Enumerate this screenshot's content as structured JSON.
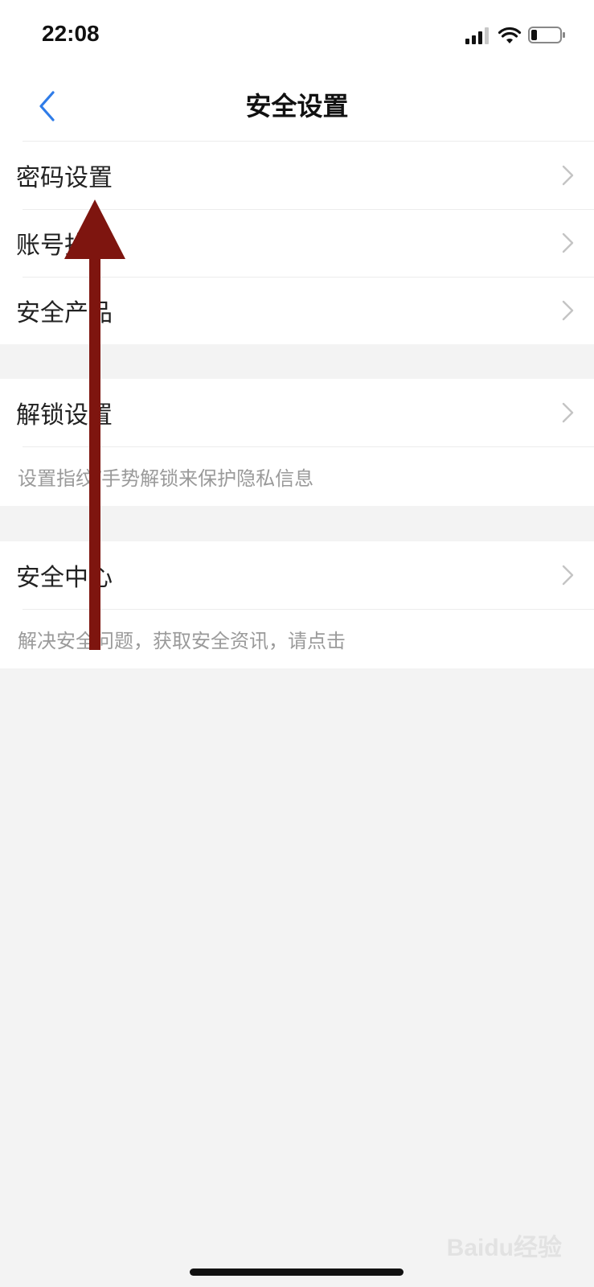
{
  "status_bar": {
    "time": "22:08",
    "icons": [
      "signal-icon",
      "wifi-icon",
      "battery-icon"
    ],
    "battery_level": 0.2
  },
  "nav": {
    "title": "安全设置",
    "back_icon": "chevron-left-icon"
  },
  "groups": [
    {
      "rows": [
        {
          "label": "密码设置"
        },
        {
          "label": "账号找回"
        },
        {
          "label": "安全产品"
        }
      ]
    },
    {
      "rows": [
        {
          "label": "解锁设置"
        }
      ],
      "description": "设置指纹/手势解锁来保护隐私信息"
    },
    {
      "rows": [
        {
          "label": "安全中心"
        }
      ],
      "description": "解决安全问题，获取安全资讯，请点击"
    }
  ],
  "overlay": {
    "annotation": "arrow-up-icon",
    "color": "#7e150f"
  },
  "watermark": "Baidu经验",
  "colors": {
    "accent": "#2f7ce8",
    "background": "#f3f3f3",
    "text": "#222222",
    "secondary_text": "#9a9a9a"
  }
}
